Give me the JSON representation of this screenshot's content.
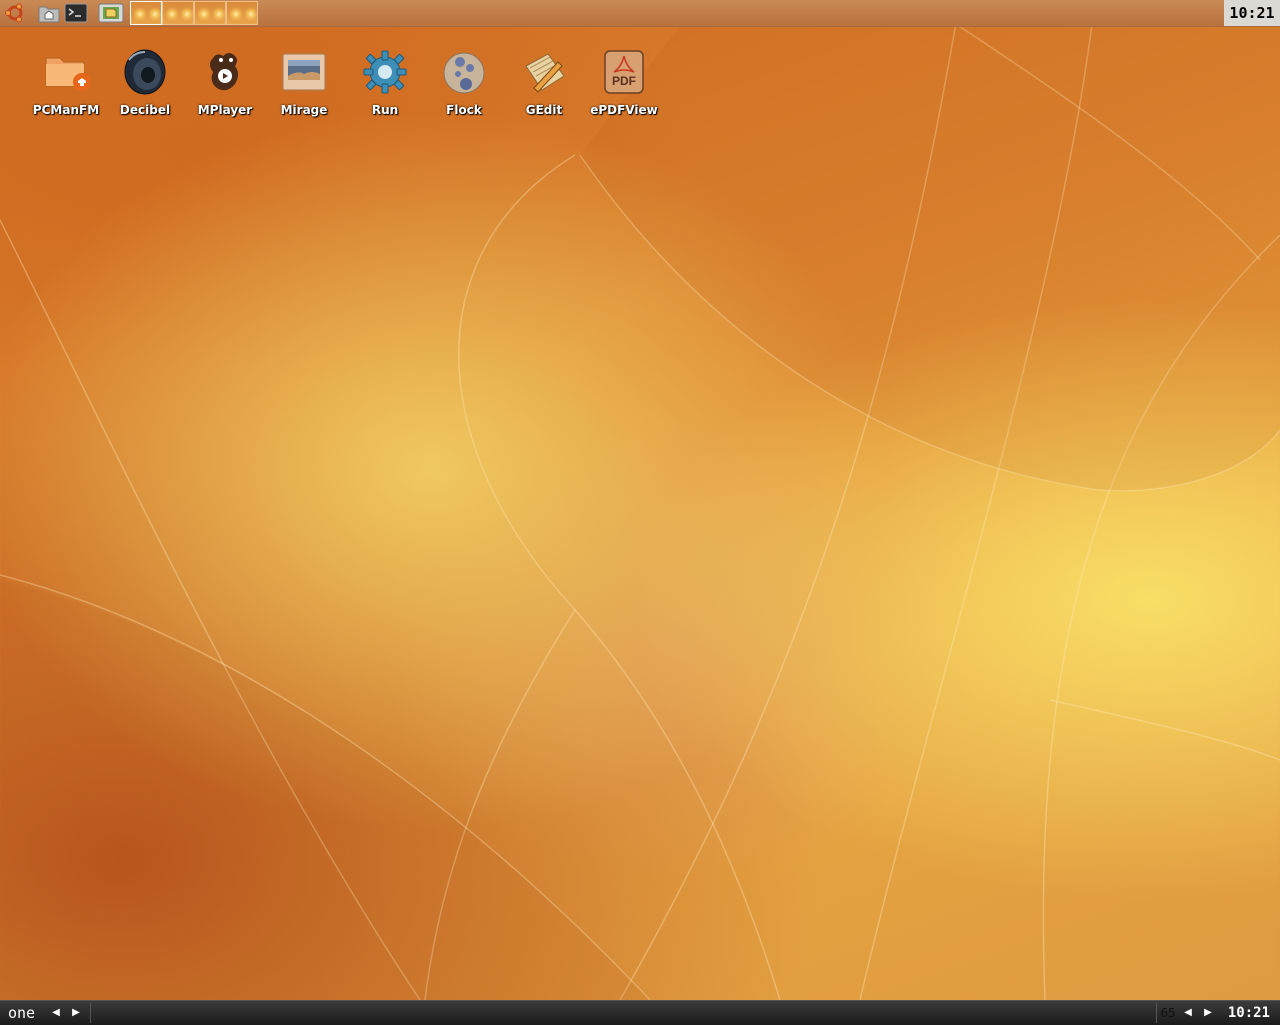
{
  "top_panel": {
    "launchers": [
      {
        "name": "ubuntu-menu-icon"
      },
      {
        "name": "home-folder-icon"
      },
      {
        "name": "terminal-icon"
      },
      {
        "name": "image-viewer-icon"
      }
    ],
    "pager_desktops": 4,
    "clock": "10:21"
  },
  "desktop": {
    "icons": [
      {
        "label": "PCManFM",
        "icon": "folder-home-icon"
      },
      {
        "label": "Decibel",
        "icon": "speaker-icon"
      },
      {
        "label": "MPlayer",
        "icon": "mplayer-gnu-icon"
      },
      {
        "label": "Mirage",
        "icon": "image-icon"
      },
      {
        "label": "Run",
        "icon": "gear-icon"
      },
      {
        "label": "Flock",
        "icon": "flock-browser-icon"
      },
      {
        "label": "GEdit",
        "icon": "notepad-pencil-icon"
      },
      {
        "label": "ePDFView",
        "icon": "pdf-icon"
      }
    ]
  },
  "bottom_panel": {
    "workspace_name": "one",
    "prev_arrow": "◀",
    "next_arrow": "▶",
    "number": "65",
    "clock": "10:21"
  },
  "colors": {
    "desktop_orange": "#dd8530",
    "desktop_yellow": "#f9de68",
    "bottom_panel": "#2a2a2a"
  }
}
